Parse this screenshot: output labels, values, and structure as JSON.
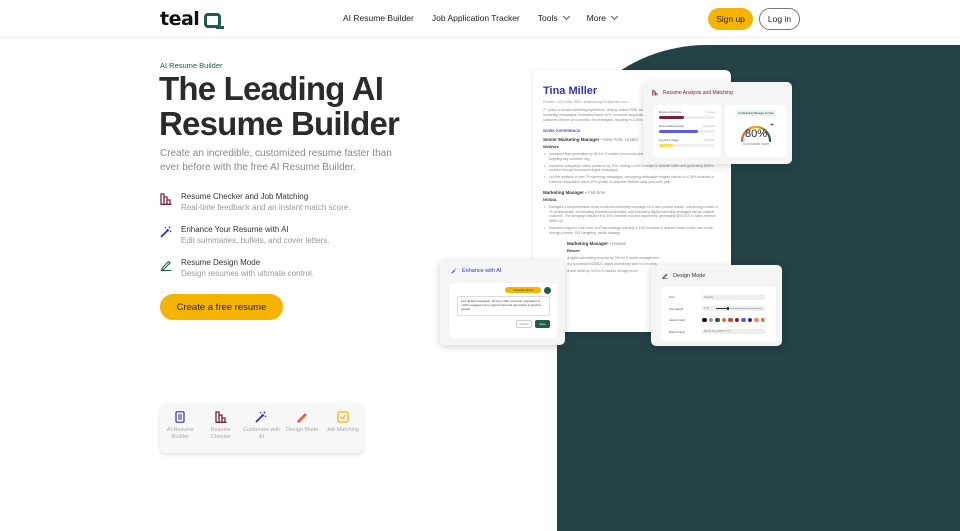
{
  "nav": {
    "logo_text": "teal",
    "links": [
      {
        "label": "AI Resume Builder",
        "dropdown": false
      },
      {
        "label": "Job Application Tracker",
        "dropdown": false
      },
      {
        "label": "Tools",
        "dropdown": true
      },
      {
        "label": "More",
        "dropdown": true
      }
    ],
    "signup_label": "Sign up",
    "login_label": "Log in"
  },
  "hero": {
    "eyebrow": "AI Resume Builder",
    "headline_line1": "The Leading AI",
    "headline_line2": "Resume Builder",
    "subtext": "Create an incredible, customized resume faster than ever before with the free AI Resume Builder.",
    "features": [
      {
        "icon": "bar-chart-icon",
        "title": "Resume Checker and Job Matching",
        "desc": "Real-time feedback and an instant match score."
      },
      {
        "icon": "magic-wand-icon",
        "title": "Enhance Your Resume with AI",
        "desc": "Edit summaries, bullets, and cover letters."
      },
      {
        "icon": "pencil-icon",
        "title": "Resume Design Mode",
        "desc": "Design resumes with ultimate control."
      }
    ],
    "cta_label": "Create a free resume"
  },
  "toolbar": {
    "items": [
      {
        "icon": "document-icon",
        "label": "AI Resume Builder",
        "color": "#3535b0"
      },
      {
        "icon": "bar-chart-icon",
        "label": "Resume Checker",
        "color": "#7a2040"
      },
      {
        "icon": "magic-wand-icon",
        "label": "Customize with AI",
        "color": "#3535b0"
      },
      {
        "icon": "pencil-icon",
        "label": "Design Mode",
        "color": "#e05a4a"
      },
      {
        "icon": "checkbox-icon",
        "label": "Job Matching",
        "color": "#f5b400"
      }
    ]
  },
  "resume": {
    "name": "Tina Miller",
    "contact": "Florida • 123-4456-7890 • tinamillerny123@gmail.com •",
    "summary": "7+ years of social marketing experience, driving custom B2B, and content marketing campaigns. Increased brand 40%, customer acquisition by 25%, customer lifetime va 6 months. Set strategies, resulting in a 45% increase in",
    "section": "WORK EXPERIENCE",
    "jobs": [
      {
        "role": "Senior Marketing Manager",
        "meta": " • New York, United",
        "company": "WeWork",
        "bullets": [
          "Increased lead generation by 35% in 3 months throu cross-channel campaigns targeting key customer seg",
          "Increased company's online presence by 25%, driving a 40% increase in website traffic and generating $2M in revenue through successful digital campaigns.",
          "Led the analysis of over 75 marketing campaigns, uncovering actionable insights that led to a 25% increase in customer acquisition and a 40% growth in customer lifetime value year-over-year."
        ]
      },
      {
        "role": "Marketing Manager",
        "meta": " • Full-time",
        "company": "NVIDIA",
        "bullets": [
          "Managed a comprehensive cross-functional marketing campaign for a new product launch, overseeing a team of 15 professionals, coordinating promotional activities, and executing digital marketing strategies across multiple channels. The campaign resulted in a 30% increase in brand awareness, generating $500,000 in sales revenue within Q1.",
          "Improved long and short form YouTube strategy resulting in 15% increase in channel views month over month through a better, SEO targeting, media strategy."
        ]
      },
      {
        "role": "Marketing Manager",
        "meta": " • Hawaii",
        "company": "Resort",
        "bullets": [
          "d digital advertising revenue by 25% in 6 month management.",
          "d a successful B2B/B2C digital advertising strat in 6 months.",
          "d web traffic by 30% in 6 months through proce"
        ]
      }
    ]
  },
  "analysis": {
    "title": "Resume Analysis and Matching",
    "rows": [
      {
        "label": "Resume Structure",
        "count": "7 Issues",
        "fill": 0.45,
        "color": "#7a2040"
      },
      {
        "label": "Measurable Results",
        "count": "21 Issues",
        "fill": 0.7,
        "color": "#5a5ae8"
      },
      {
        "label": "Keyword Usage",
        "count": "5 Issues",
        "fill": 0.25,
        "color": "#f5e050"
      }
    ],
    "badge": "Sr Marketing Manager at Crate",
    "score": "80%",
    "score_value": 0.8,
    "score_label": "Good Match Score"
  },
  "enhance": {
    "title": "Enhance with AI",
    "pill": "Generate with AI",
    "text": "Led global campaigns, driving +30% customer acquisition & +15% engagement to support demand generation & pipeline growth.",
    "cancel": "Cancel",
    "save": "Save"
  },
  "design": {
    "title": "Design Mode",
    "font_label": "Font",
    "font_value": "Poppins",
    "line_height_label": "Line Height",
    "line_height_value": "1.15",
    "accent_label": "Accent Color",
    "accent_colors": [
      "#111111",
      "#999999",
      "#1f5a4a",
      "#b08840",
      "#e04030",
      "#7a2040",
      "#5a5ae8",
      "#2a2aa0",
      "#f58a40",
      "rainbow"
    ],
    "date_label": "Date Format",
    "date_value": "Month Year (MM/YYYY)"
  },
  "colors": {
    "brand_teal": "#1f5a4a",
    "dark_bg": "#244246",
    "accent_yellow": "#f5b400"
  }
}
